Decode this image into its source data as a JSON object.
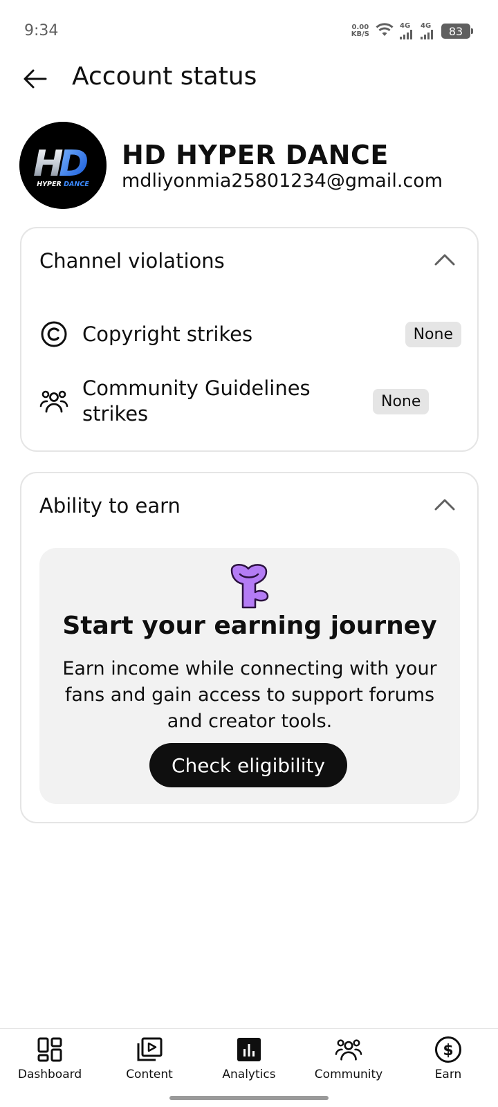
{
  "status_bar": {
    "time": "9:34",
    "net_speed_value": "0.00",
    "net_speed_unit": "KB/S",
    "signal_1": "4G",
    "signal_2": "4G",
    "battery": "83"
  },
  "header": {
    "title": "Account status"
  },
  "channel": {
    "name": "HD HYPER DANCE",
    "email": "mdliyonmia25801234@gmail.com",
    "avatar_text": "HD",
    "avatar_subtext": "HYPER DANCE"
  },
  "violations": {
    "title": "Channel violations",
    "items": [
      {
        "label": "Copyright strikes",
        "status": "None",
        "icon": "copyright-icon"
      },
      {
        "label": "Community Guidelines strikes",
        "status": "None",
        "icon": "community-icon"
      }
    ]
  },
  "earn": {
    "title": "Ability to earn",
    "heading": "Start your earning journey",
    "description": "Earn income while connecting with your fans and gain access to support forums and creator tools.",
    "button": "Check eligibility"
  },
  "nav": {
    "items": [
      {
        "label": "Dashboard",
        "icon": "dashboard-icon"
      },
      {
        "label": "Content",
        "icon": "content-icon"
      },
      {
        "label": "Analytics",
        "icon": "analytics-icon"
      },
      {
        "label": "Community",
        "icon": "community-icon"
      },
      {
        "label": "Earn",
        "icon": "earn-icon"
      }
    ]
  },
  "colors": {
    "text": "#0f0f0f",
    "border": "#e5e5e5",
    "badge_bg": "#e5e5e5",
    "panel_bg": "#f2f2f2",
    "mascot": "#b47cf5",
    "logo_blue": "#1e7bff"
  }
}
